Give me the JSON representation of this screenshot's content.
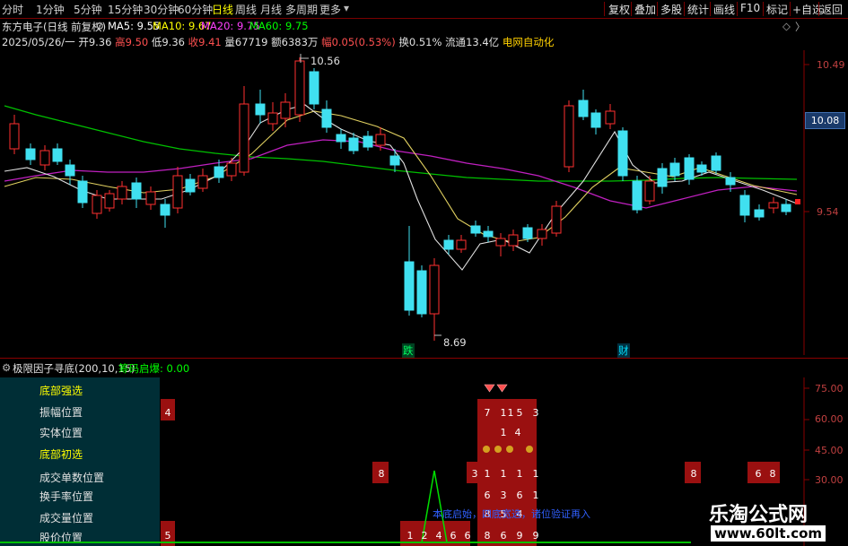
{
  "toolbar": {
    "periods": [
      "分时",
      "1分钟",
      "5分钟",
      "15分钟",
      "30分钟",
      "60分钟",
      "日线",
      "周线",
      "月线",
      "多周期",
      "更多"
    ],
    "active_period": "日线",
    "right_buttons": [
      "复权",
      "叠加",
      "多股",
      "统计",
      "画线",
      "F10",
      "标记",
      "+自选",
      "返回"
    ]
  },
  "header": {
    "stock_title": "东方电子(日线 前复权)",
    "ma_labels": [
      "MA5: 9.55",
      "MA10: 9.67",
      "MA20: 9.75",
      "MA60: 9.75"
    ],
    "ma_colors": [
      "#ffffff",
      "#ffff00",
      "#ff40ff",
      "#00ff00"
    ],
    "date": "2025/05/26/一",
    "open_label": "开",
    "open": "9.36",
    "high_label": "高",
    "high": "9.50",
    "low_label": "低",
    "low": "9.36",
    "close_label": "收",
    "close": "9.41",
    "volume_label": "量",
    "volume": "67719",
    "amount_label": "额",
    "amount": "6383万",
    "change_label": "幅",
    "change": "0.05(0.53%)",
    "turnover_label": "换",
    "turnover": "0.51%",
    "float_label": "流通",
    "float": "13.4亿",
    "sector": "电网自动化"
  },
  "price_axis": {
    "labels": [
      "10.49",
      "9.54"
    ],
    "current_price": "10.08"
  },
  "annotations": {
    "high_marker": "10.56",
    "low_marker": "8.69",
    "fall_tag": "跌",
    "finance_tag": "财"
  },
  "indicator": {
    "title": "极限因子寻底(200,10,15)",
    "extra_label": "筹码启爆: 0.00",
    "axis_labels": [
      "75.00",
      "60.00",
      "45.00",
      "30.00"
    ],
    "row_labels": [
      {
        "text": "底部强选",
        "highlight": true
      },
      {
        "text": "振幅位置",
        "highlight": false
      },
      {
        "text": "实体位置",
        "highlight": false
      },
      {
        "text": "底部初选",
        "highlight": true
      },
      {
        "text": "成交单数位置",
        "highlight": false
      },
      {
        "text": "换手率位置",
        "highlight": false
      },
      {
        "text": "成交量位置",
        "highlight": false
      },
      {
        "text": "股价位置",
        "highlight": false
      }
    ],
    "cells": [
      {
        "t": "4"
      },
      {
        "t": "8"
      },
      {
        "t": "3"
      },
      {
        "t": "7"
      },
      {
        "t": "1"
      },
      {
        "t": "1"
      },
      {
        "t": "1"
      },
      {
        "t": "8"
      },
      {
        "t": "6"
      },
      {
        "t": "8"
      },
      {
        "t": "5"
      },
      {
        "t": "4"
      },
      {
        "t": "1"
      },
      {
        "t": "1"
      },
      {
        "t": "1"
      },
      {
        "t": "2"
      },
      {
        "t": "6"
      },
      {
        "t": "6"
      },
      {
        "t": "3"
      },
      {
        "t": "6"
      },
      {
        "t": "1"
      },
      {
        "t": "1"
      },
      {
        "t": "5"
      },
      {
        "t": "8"
      },
      {
        "t": "9"
      },
      {
        "t": "6"
      },
      {
        "t": "5"
      },
      {
        "t": "9"
      },
      {
        "t": "1"
      },
      {
        "t": "4"
      }
    ],
    "overlay_text": "本底启始，四底宽选，诸位验证再入"
  },
  "watermark": {
    "title": "乐淘公式网",
    "url": "www.60lt.com"
  }
}
